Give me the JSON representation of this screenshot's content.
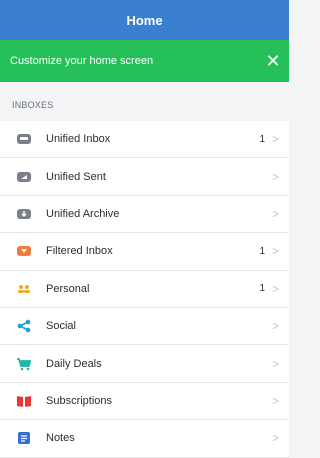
{
  "header": {
    "title": "Home"
  },
  "banner": {
    "text": "Customize your home screen",
    "close_glyph": "✕"
  },
  "inboxes": {
    "section_label": "INBOXES",
    "items": [
      {
        "label": "Unified Inbox",
        "count": "1",
        "icon": "inbox-icon",
        "color": "#7b7f87"
      },
      {
        "label": "Unified Sent",
        "count": "",
        "icon": "sent-icon",
        "color": "#7b7f87"
      },
      {
        "label": "Unified Archive",
        "count": "",
        "icon": "archive-icon",
        "color": "#7b7f87"
      },
      {
        "label": "Filtered Inbox",
        "count": "1",
        "icon": "filter-icon",
        "color": "#f07a39"
      },
      {
        "label": "Personal",
        "count": "1",
        "icon": "people-icon",
        "color": "#f1a52e"
      },
      {
        "label": "Social",
        "count": "",
        "icon": "share-icon",
        "color": "#1aa0df"
      },
      {
        "label": "Daily Deals",
        "count": "",
        "icon": "cart-icon",
        "color": "#1fb7a6"
      },
      {
        "label": "Subscriptions",
        "count": "",
        "icon": "book-icon",
        "color": "#e53935"
      },
      {
        "label": "Notes",
        "count": "",
        "icon": "notes-icon",
        "color": "#2f6fd6"
      }
    ]
  },
  "chevron_glyph": ">"
}
